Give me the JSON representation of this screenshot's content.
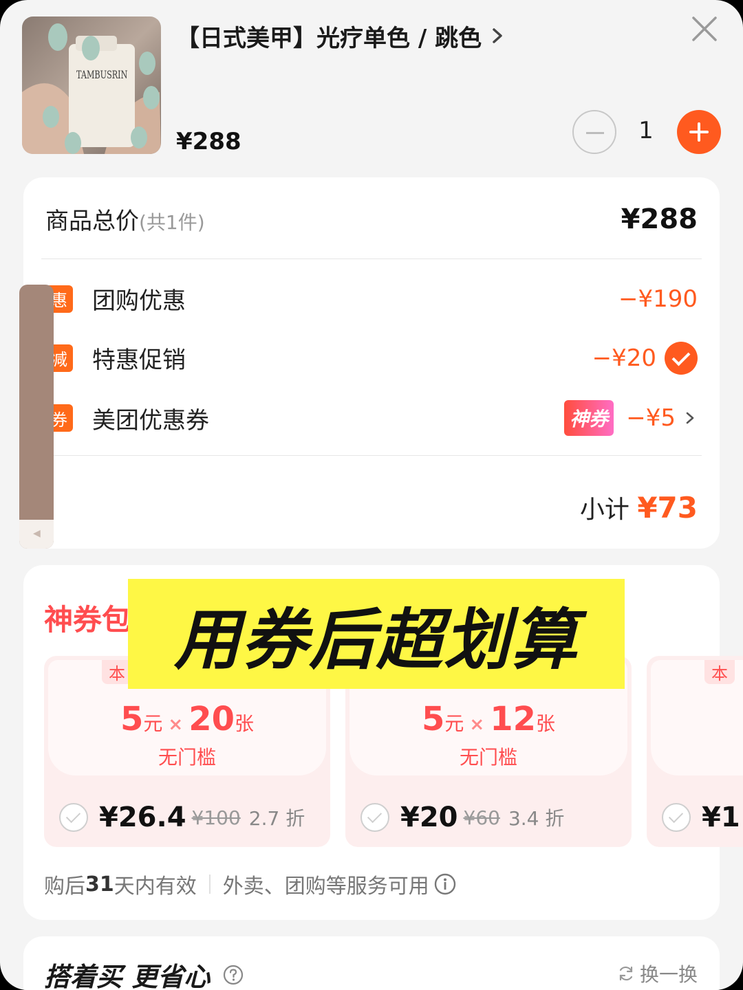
{
  "product": {
    "title": "【日式美甲】光疗单色 / 跳色",
    "price": "¥288",
    "image_brand": "TAMBUSRIN",
    "quantity": "1"
  },
  "summary": {
    "total_label": "商品总价",
    "total_count": "(共1件)",
    "total_value": "¥288",
    "discounts": [
      {
        "tag": "惠",
        "label": "团购优惠",
        "value": "−¥190"
      },
      {
        "tag": "减",
        "label": "特惠促销",
        "value": "−¥20"
      },
      {
        "tag": "券",
        "label": "美团优惠券",
        "badge": "神券",
        "value": "−¥5"
      }
    ],
    "subtotal_label": "小计",
    "subtotal_value": "¥73"
  },
  "coupon_section": {
    "title": "神券包",
    "overlay_text": "用券后超划算",
    "coupons": [
      {
        "tag": "本",
        "amount": "5",
        "unit": "元",
        "times": "×",
        "count": "20",
        "count_unit": "张",
        "condition": "无门槛",
        "price": "¥26.4",
        "original": "¥100",
        "discount": "2.7 折"
      },
      {
        "amount": "5",
        "unit": "元",
        "times": "×",
        "count": "12",
        "count_unit": "张",
        "condition": "无门槛",
        "price": "¥20",
        "original": "¥60",
        "discount": "3.4 折"
      },
      {
        "tag": "本",
        "price": "¥1"
      }
    ],
    "validity_prefix": "购后",
    "validity_days": "31",
    "validity_suffix": "天内有效",
    "usage": "外卖、团购等服务可用"
  },
  "bundle": {
    "title": "搭着买 更省心",
    "refresh_label": "换一换"
  },
  "colors": {
    "accent": "#ff5a1f",
    "coupon_red": "#ff4d4f",
    "overlay_yellow": "#fef745",
    "handle_brown": "#a48779"
  }
}
